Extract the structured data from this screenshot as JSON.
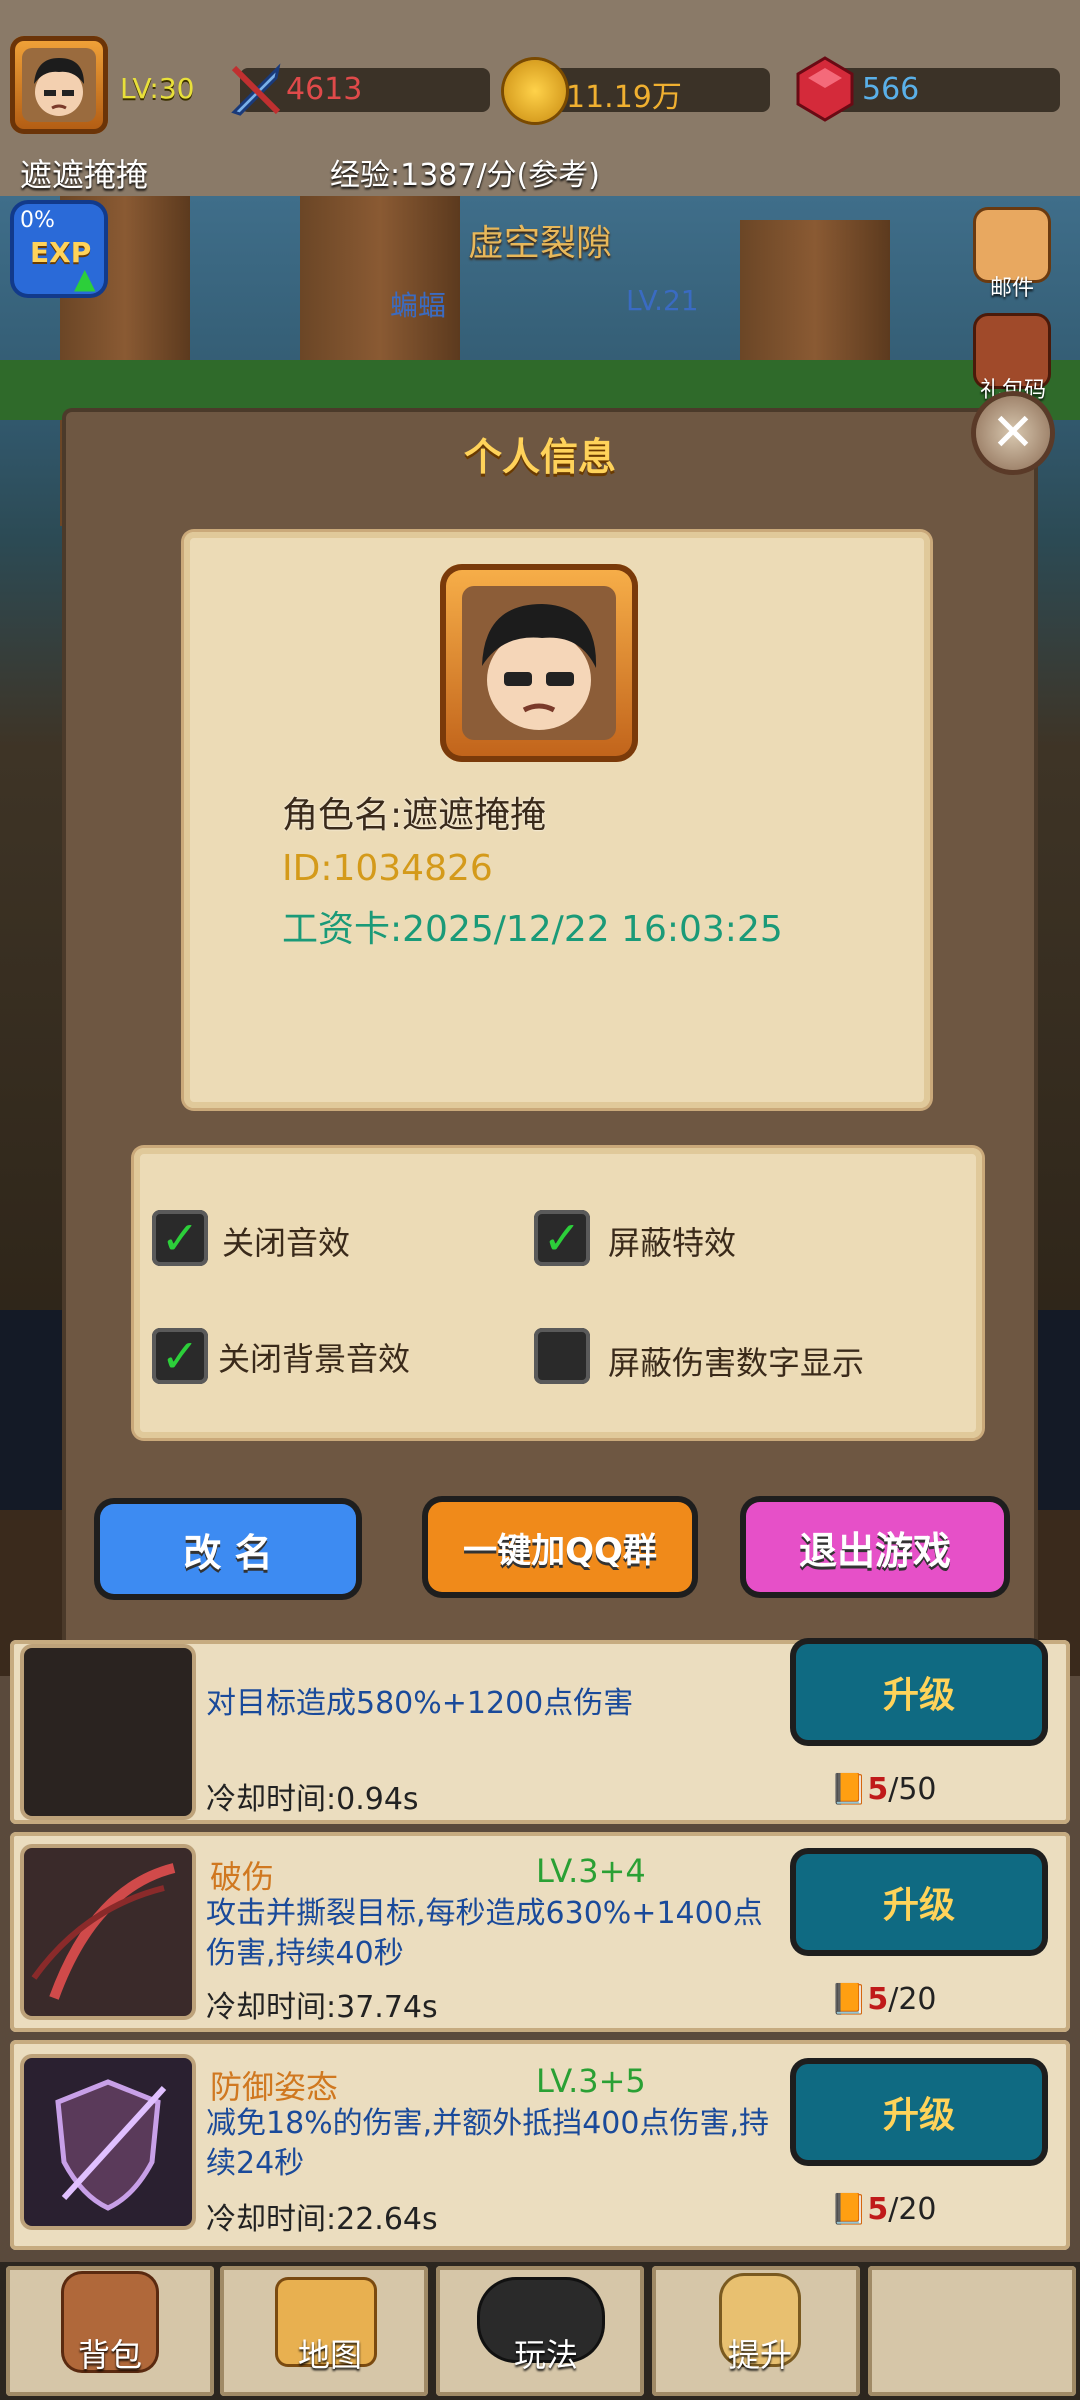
{
  "player": {
    "level_label": "LV:30",
    "name": "遮遮掩掩",
    "power": "4613",
    "gold": "11.19万",
    "gems": "566",
    "exp_rate": "经验:1387/分(参考)"
  },
  "scene": {
    "area_name": "虚空裂隙",
    "enemy_name": "蝙蝠",
    "enemy_level": "LV.21",
    "exp_badge_pct": "0%",
    "exp_badge_label": "EXP",
    "side_mail": "邮件",
    "side_gift": "礼包码"
  },
  "modal": {
    "title": "个人信息",
    "name_line": "角色名:遮遮掩掩",
    "id_line": "ID:1034826",
    "card_line": "工资卡:2025/12/22 16:03:25",
    "options": [
      {
        "label": "关闭音效",
        "checked": true
      },
      {
        "label": "屏蔽特效",
        "checked": true
      },
      {
        "label": "关闭背景音效",
        "checked": true
      },
      {
        "label": "屏蔽伤害数字显示",
        "checked": false
      }
    ],
    "btn_rename": "改 名",
    "btn_qq": "一键加QQ群",
    "btn_exit": "退出游戏",
    "colors": {
      "rename": "#3d8bf2",
      "qq": "#f08a1a",
      "exit": "#e650c8"
    }
  },
  "skills": [
    {
      "name": "",
      "level": "",
      "desc": "对目标造成580%+1200点伤害",
      "cooldown": "冷却时间:0.94s",
      "upgrade": "升级",
      "cost_have": "5",
      "cost_need": "/50"
    },
    {
      "name": "破伤",
      "level": "LV.3+4",
      "desc": "攻击并撕裂目标,每秒造成630%+1400点伤害,持续40秒",
      "cooldown": "冷却时间:37.74s",
      "upgrade": "升级",
      "cost_have": "5",
      "cost_need": "/20"
    },
    {
      "name": "防御姿态",
      "level": "LV.3+5",
      "desc": "减免18%的伤害,并额外抵挡400点伤害,持续24秒",
      "cooldown": "冷却时间:22.64s",
      "upgrade": "升级",
      "cost_have": "5",
      "cost_need": "/20"
    }
  ],
  "nav": {
    "bag": "背包",
    "map": "地图",
    "play": "玩法",
    "upgrade": "提升"
  }
}
